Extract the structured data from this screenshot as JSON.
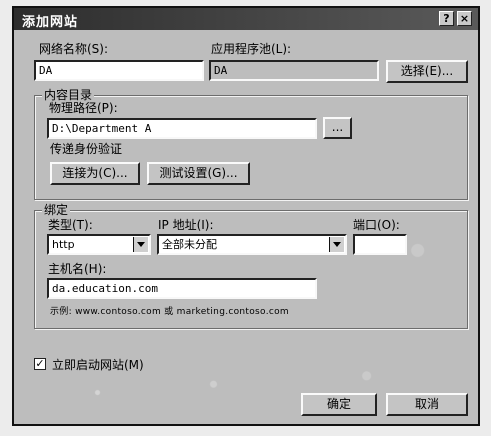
{
  "window": {
    "title": "添加网站",
    "help_glyph": "?",
    "close_glyph": "×"
  },
  "site": {
    "name_label": "网络名称(S):",
    "name_value": "DA",
    "app_pool_label": "应用程序池(L):",
    "app_pool_value": "DA",
    "select_button": "选择(E)..."
  },
  "content_directory": {
    "legend": "内容目录",
    "physical_path_label": "物理路径(P):",
    "physical_path_value": "D:\\Department A",
    "browse_button": "...",
    "auth_label": "传递身份验证",
    "connect_as_button": "连接为(C)...",
    "test_settings_button": "测试设置(G)..."
  },
  "binding": {
    "legend": "绑定",
    "type_label": "类型(T):",
    "type_value": "http",
    "ip_label": "IP 地址(I):",
    "ip_value": "全部未分配",
    "port_label": "端口(O):",
    "port_value": "",
    "host_label": "主机名(H):",
    "host_value": "da.education.com",
    "example_text": "示例: www.contoso.com 或 marketing.contoso.com"
  },
  "start_site": {
    "label": "立即启动网站(M)",
    "checked_glyph": "✓"
  },
  "footer": {
    "ok_button": "确定",
    "cancel_button": "取消"
  }
}
